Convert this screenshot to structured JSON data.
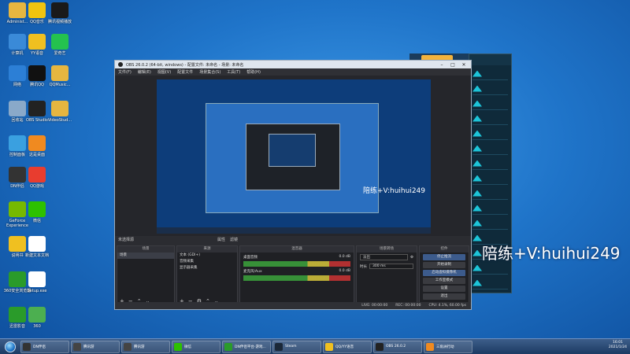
{
  "desktop_icons": [
    {
      "label": "Administ...",
      "color": "#e6b640"
    },
    {
      "label": "QQ音乐",
      "color": "#f1c40f"
    },
    {
      "label": "腾讯视频播放",
      "color": "#1a1a1a"
    },
    {
      "label": "计算机",
      "color": "#3a8ad8"
    },
    {
      "label": "YY语音",
      "color": "#f0c020"
    },
    {
      "label": "爱奇艺",
      "color": "#24c24e"
    },
    {
      "label": "网络",
      "color": "#2c7fd6"
    },
    {
      "label": "腾讯QQ",
      "color": "#111111"
    },
    {
      "label": "QQMusic...",
      "color": "#e6b640"
    },
    {
      "label": "回收站",
      "color": "#8aa9c9"
    },
    {
      "label": "OBS Studio",
      "color": "#222222"
    },
    {
      "label": "VideoStud...",
      "color": "#e6b640"
    },
    {
      "label": "控制面板",
      "color": "#3aa0e0"
    },
    {
      "label": "这是桌面",
      "color": "#f08a20"
    },
    {
      "label": "DN伴侣",
      "color": "#333333"
    },
    {
      "label": "QQ游戏",
      "color": "#e83d2f"
    },
    {
      "label": "GeForce Experience",
      "color": "#76b900"
    },
    {
      "label": "微信",
      "color": "#2dc100"
    },
    {
      "label": "说明书",
      "color": "#f0c020"
    },
    {
      "label": "新建文本文档",
      "color": "#ffffff"
    },
    {
      "label": "360安全浏览器",
      "color": "#2a9b2a"
    },
    {
      "label": "Setup.exe",
      "color": "#ffffff"
    },
    {
      "label": "迅雷影音",
      "color": "#2a9b2a"
    },
    {
      "label": "360",
      "color": "#4caf50"
    }
  ],
  "obs": {
    "title": "OBS 26.0.2 (64-bit, windows) - 配置文件: 未命名 - 场景: 未命名",
    "menu": [
      "文件(F)",
      "编辑(E)",
      "视图(V)",
      "配置文件",
      "场景集合(S)",
      "工具(T)",
      "帮助(H)"
    ],
    "preview_watermark": "陪练+V:huihui249",
    "no_source_bar": [
      "未选择源",
      "属性",
      "滤镜"
    ],
    "docks": {
      "scenes": {
        "title": "场景",
        "items": [
          "场景"
        ]
      },
      "sources": {
        "title": "来源",
        "items": [
          "文本 (GDI+)",
          "音频采集",
          "显示器采集"
        ]
      },
      "mixer": {
        "title": "混音器",
        "channels": [
          {
            "name": "桌面音频",
            "db": "0.0 dB"
          },
          {
            "name": "麦克风/Aux",
            "db": "0.0 dB"
          }
        ]
      },
      "transitions": {
        "title": "场景转场",
        "type": "淡出",
        "duration_label": "时长",
        "duration": "300 ms"
      },
      "controls": {
        "title": "控件",
        "buttons": [
          "停止推流",
          "开始录制",
          "启动虚拟摄像机",
          "工作室模式",
          "设置",
          "退出"
        ]
      }
    },
    "status": {
      "live": "LIVE: 00:00:00",
      "rec": "REC: 00:00:00",
      "cpu": "CPU: 4.1%, 60.00 fps"
    }
  },
  "overlay_watermark": "陪练+V:huihui249",
  "taskbar": {
    "items": [
      {
        "label": "DN伴侣",
        "color": "#333333"
      },
      {
        "label": "腾讯游",
        "color": "#444444"
      },
      {
        "label": "腾讯游",
        "color": "#444444"
      },
      {
        "label": "微信",
        "color": "#2dc100"
      },
      {
        "label": "DN伴侣平台-游戏...",
        "color": "#2a9b2a"
      },
      {
        "label": "Steam",
        "color": "#1b2838"
      },
      {
        "label": "QQ/YY语音",
        "color": "#f0c020"
      },
      {
        "label": "OBS 26.0.2",
        "color": "#222222"
      },
      {
        "label": "三角洲行动",
        "color": "#f08a20"
      }
    ],
    "time": "16:01",
    "date": "2021/1/24"
  }
}
